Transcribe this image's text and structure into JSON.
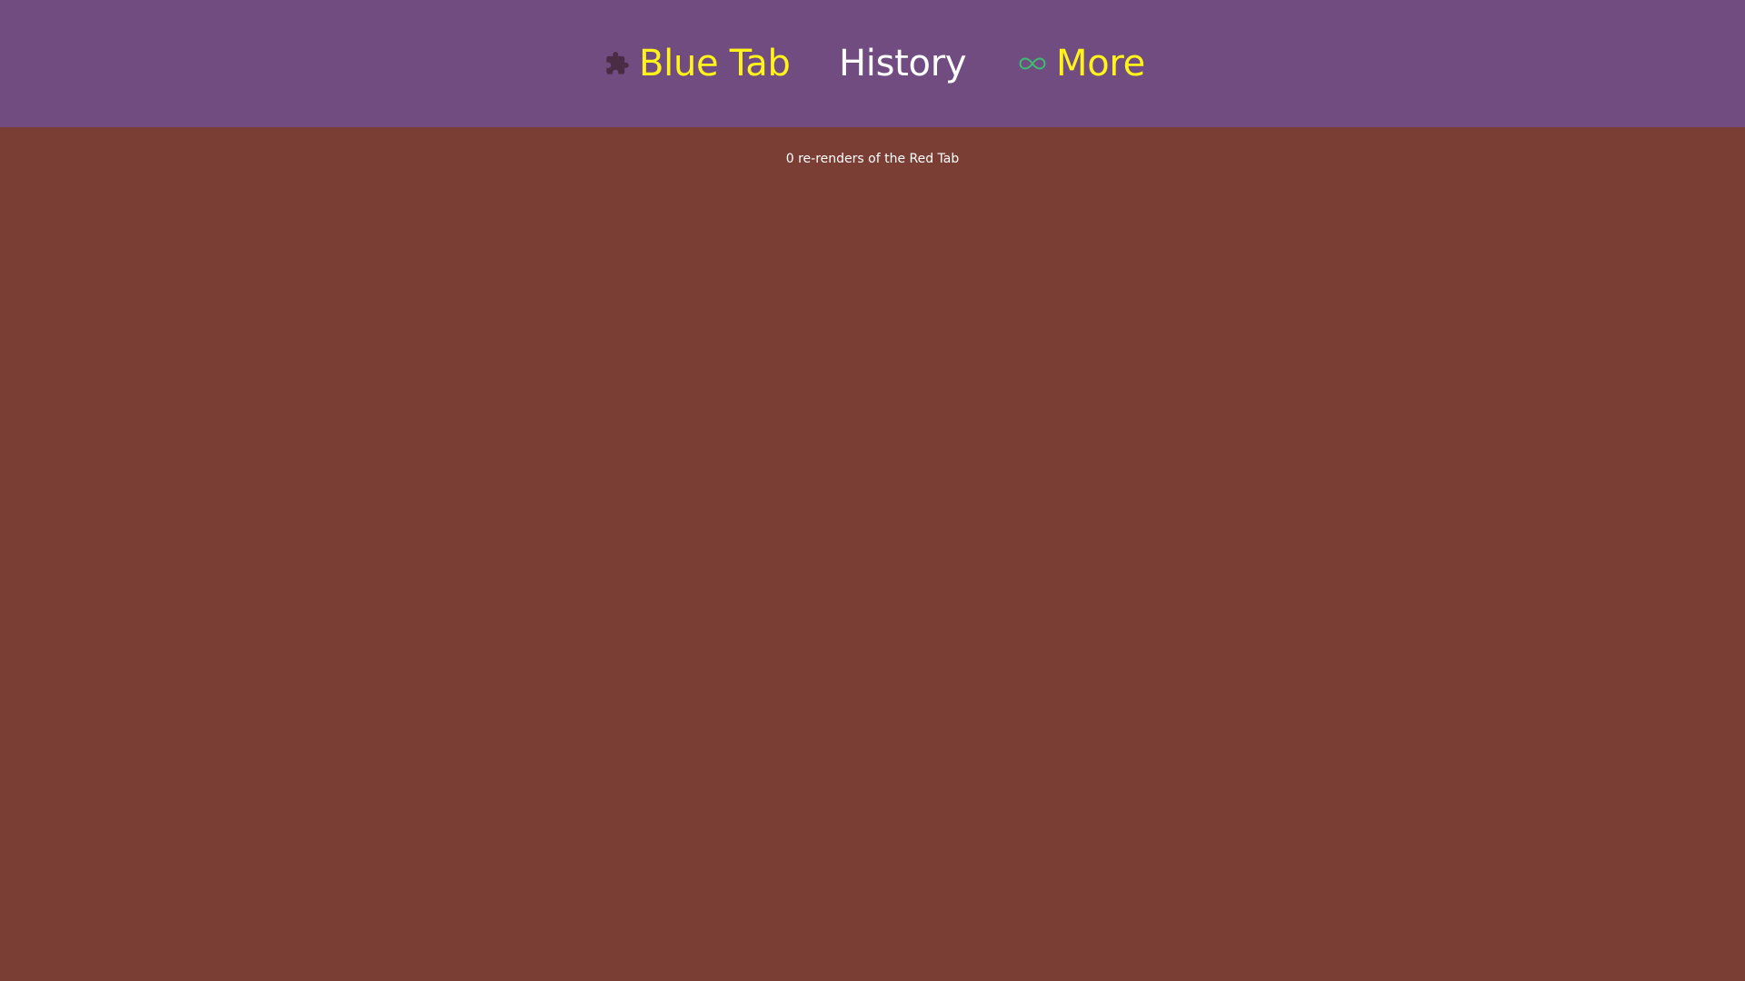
{
  "colors": {
    "tab_bar_background": "#704c80",
    "content_background": "#7a3e34",
    "active_tab_text": "#fff31a",
    "inactive_tab_text": "#ffffff",
    "puzzle_icon_color": "#4a2c44",
    "infinity_icon_color": "#3dbb72",
    "counter_text": "#ffffff"
  },
  "tabs": [
    {
      "label": "Blue Tab",
      "icon": "puzzle-icon"
    },
    {
      "label": "History",
      "icon": ""
    },
    {
      "label": "More",
      "icon": "infinity-icon"
    }
  ],
  "content": {
    "counter_text": "0 re-renders of the Red Tab"
  }
}
